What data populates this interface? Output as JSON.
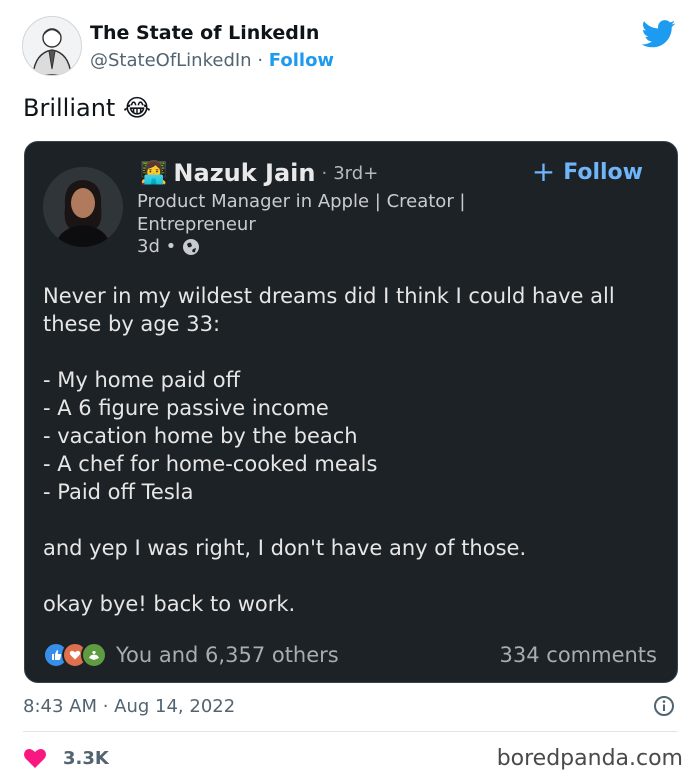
{
  "tweet": {
    "author_name": "The State of LinkedIn",
    "author_handle": "@StateOfLinkedIn",
    "separator": "·",
    "follow_label": "Follow",
    "text": "Brilliant 😂",
    "time": "8:43 AM · Aug 14, 2022",
    "like_count": "3.3K"
  },
  "linkedin_post": {
    "emoji": "👩‍💻",
    "name": "Nazuk Jain",
    "degree": "3rd+",
    "follow_label": "Follow",
    "headline": "Product Manager in Apple | Creator | Entrepreneur",
    "age": "3d •",
    "body": [
      "Never in my wildest dreams did I think I could have all these by age 33:",
      "",
      "- My home paid off",
      "- A 6 figure passive income",
      "- vacation home by the beach",
      "- A chef for home-cooked meals",
      "- Paid off Tesla",
      "",
      "and yep I was right, I don't have any of those.",
      "",
      "okay bye! back to work."
    ],
    "reactions_text": "You and 6,357 others",
    "comments_text": "334 comments"
  },
  "watermark": "boredpanda.com",
  "colors": {
    "twitter_blue": "#1d9bf0",
    "linkedin_blue": "#70b5f9",
    "card_bg": "#1d2226",
    "heart": "#f91880"
  },
  "icons": [
    "twitter-bird-icon",
    "globe-icon",
    "info-icon",
    "heart-icon",
    "like-reaction-icon",
    "love-reaction-icon",
    "support-reaction-icon"
  ]
}
